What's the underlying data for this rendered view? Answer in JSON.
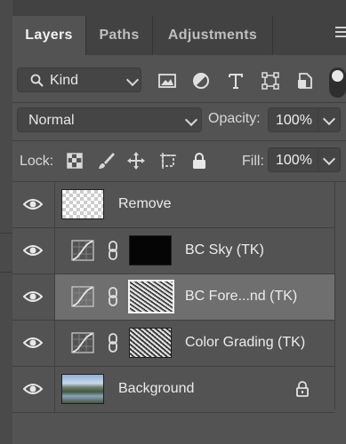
{
  "tabs": [
    {
      "label": "Layers",
      "active": true
    },
    {
      "label": "Paths",
      "active": false
    },
    {
      "label": "Adjustments",
      "active": false
    }
  ],
  "filter": {
    "kind_label": "Kind",
    "icons": [
      "image-filter-icon",
      "adjustment-filter-icon",
      "type-filter-icon",
      "shape-filter-icon",
      "smart-object-filter-icon"
    ]
  },
  "blend": {
    "mode": "Normal",
    "opacity_label": "Opacity:",
    "opacity": "100%"
  },
  "lock": {
    "label": "Lock:",
    "fill_label": "Fill:",
    "fill": "100%"
  },
  "layers": [
    {
      "name": "Remove",
      "visible": true,
      "type": "pixel",
      "selected": false
    },
    {
      "name": "BC Sky (TK)",
      "visible": true,
      "type": "curves",
      "selected": false
    },
    {
      "name": "BC Fore...nd (TK)",
      "visible": true,
      "type": "curves",
      "selected": true
    },
    {
      "name": "Color Grading (TK)",
      "visible": true,
      "type": "curves",
      "selected": false
    },
    {
      "name": "Background",
      "visible": true,
      "type": "background",
      "locked": true,
      "selected": false
    }
  ],
  "colors": {
    "panel": "#535353",
    "tabbar": "#424242",
    "selected_row": "#6f6f6f"
  }
}
